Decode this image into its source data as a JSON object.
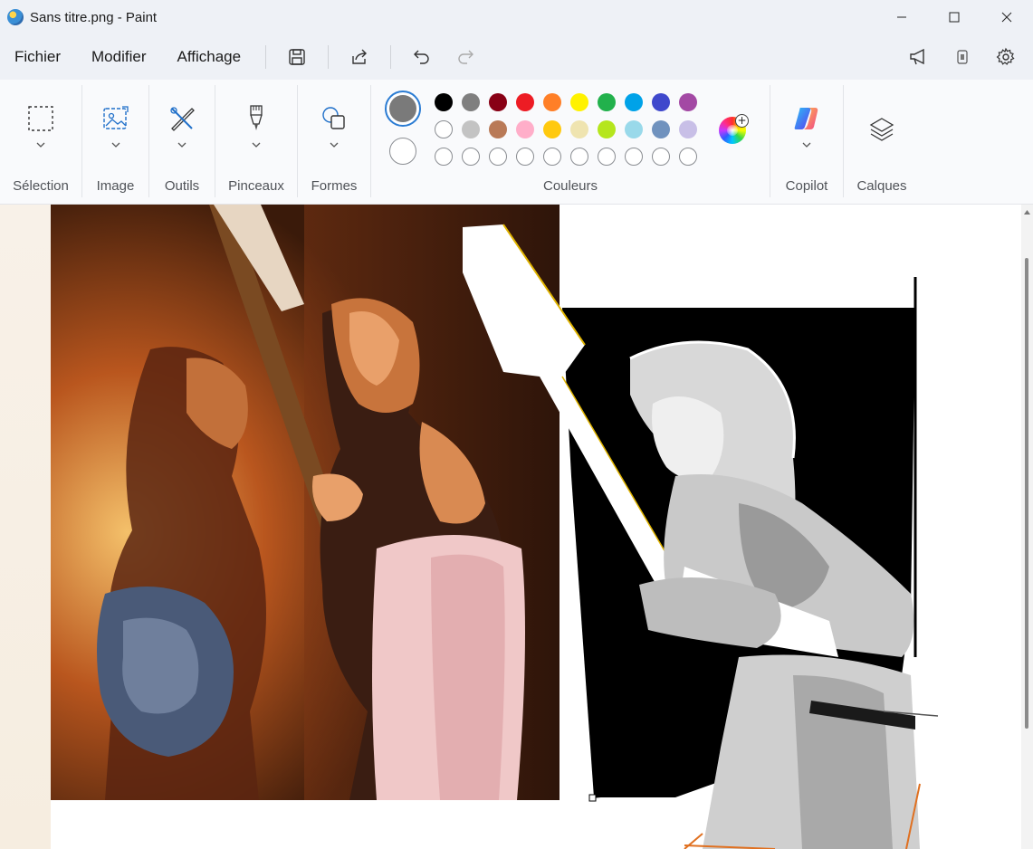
{
  "window": {
    "title": "Sans titre.png - Paint"
  },
  "menu": {
    "items": [
      "Fichier",
      "Modifier",
      "Affichage"
    ]
  },
  "ribbon": {
    "groups": {
      "selection": "Sélection",
      "image": "Image",
      "tools": "Outils",
      "brushes": "Pinceaux",
      "shapes": "Formes",
      "colors": "Couleurs",
      "copilot": "Copilot",
      "layers": "Calques"
    },
    "primary_color": "#7a7a7a",
    "secondary_color": "#ffffff",
    "palette_row1": [
      "#000000",
      "#7f7f7f",
      "#880015",
      "#ed1c24",
      "#ff7f27",
      "#fff200",
      "#22b14c",
      "#00a2e8",
      "#3f48cc",
      "#a349a4"
    ],
    "palette_row2": [
      "#ffffff",
      "#c3c3c3",
      "#b97a57",
      "#ffaec9",
      "#ffc90e",
      "#efe4b0",
      "#b5e61d",
      "#99d9ea",
      "#7092be",
      "#c8bfe7"
    ],
    "palette_row3_empty_count": 10
  },
  "icons": {
    "app": "paint-app-icon",
    "save": "save-icon",
    "share": "share-icon",
    "undo": "undo-icon",
    "redo": "redo-icon",
    "announce": "megaphone-icon",
    "account": "account-badge-icon",
    "settings": "gear-icon"
  },
  "accent_color": "#2b7cd3"
}
